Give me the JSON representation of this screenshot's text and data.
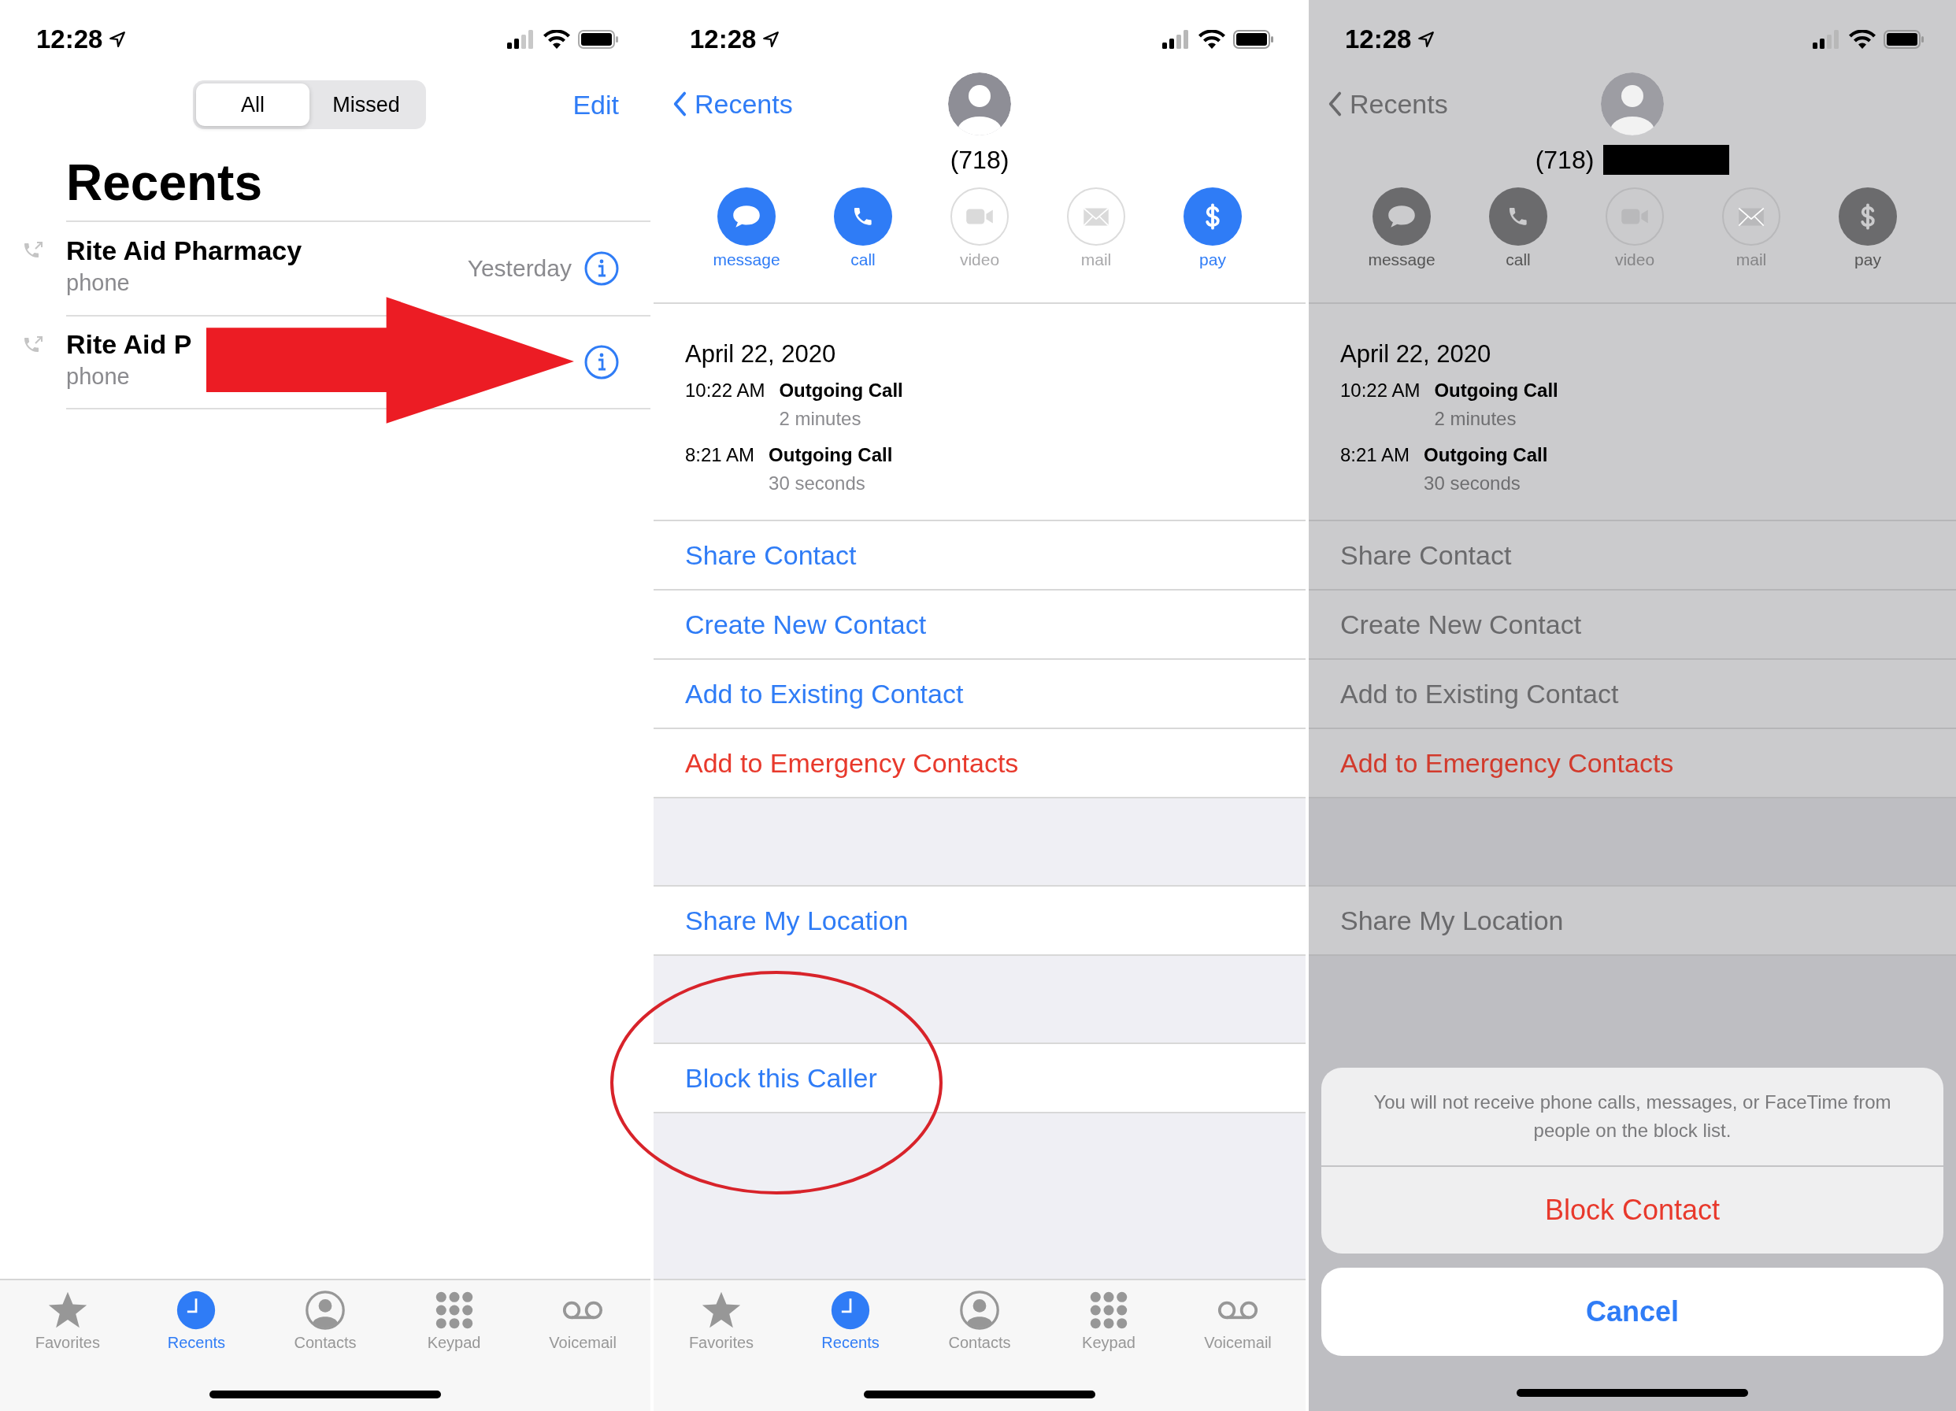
{
  "recents_screen": {
    "status": {
      "time": "12:28"
    },
    "segments": [
      {
        "label": "All",
        "selected": true
      },
      {
        "label": "Missed",
        "selected": false
      }
    ],
    "edit": "Edit",
    "title": "Recents",
    "calls": [
      {
        "name": "Rite Aid Pharmacy",
        "type": "phone",
        "date": "Yesterday"
      },
      {
        "name": "Rite Aid P",
        "type": "phone"
      }
    ],
    "annotation": {
      "kind": "arrow"
    },
    "tab_bar": [
      {
        "label": "Favorites",
        "kind": "star",
        "selected": false
      },
      {
        "label": "Recents",
        "kind": "clock",
        "selected": true
      },
      {
        "label": "Contacts",
        "kind": "person",
        "selected": false
      },
      {
        "label": "Keypad",
        "kind": "keypad",
        "selected": false
      },
      {
        "label": "Voicemail",
        "kind": "voicemail",
        "selected": false
      }
    ]
  },
  "detail_screens": [
    {
      "dimmed": false,
      "status": {
        "time": "12:28"
      },
      "back": "Recents",
      "number": "(718)",
      "redacted": false,
      "actions": [
        {
          "label": "message",
          "kind": "message",
          "disabled": false
        },
        {
          "label": "call",
          "kind": "call",
          "disabled": false
        },
        {
          "label": "video",
          "kind": "video",
          "disabled": true
        },
        {
          "label": "mail",
          "kind": "mail",
          "disabled": true
        },
        {
          "label": "pay",
          "kind": "pay",
          "disabled": false
        }
      ],
      "date": "April 22, 2020",
      "history": [
        {
          "time": "10:22 AM",
          "type": "Outgoing Call",
          "duration": "2 minutes"
        },
        {
          "time": "8:21 AM",
          "type": "Outgoing Call",
          "duration": "30 seconds"
        }
      ],
      "sections": [
        {
          "items": [
            {
              "label": "Share Contact",
              "destructive": false
            },
            {
              "label": "Create New Contact",
              "destructive": false
            },
            {
              "label": "Add to Existing Contact",
              "destructive": false
            },
            {
              "label": "Add to Emergency Contacts",
              "destructive": true
            }
          ]
        },
        {
          "items": [
            {
              "label": "Share My Location",
              "destructive": false
            }
          ]
        },
        {
          "items": [
            {
              "label": "Block this Caller",
              "destructive": false
            }
          ]
        }
      ],
      "annotation": {
        "kind": "ellipse"
      },
      "tab_bar": [
        {
          "label": "Favorites",
          "kind": "star",
          "selected": false
        },
        {
          "label": "Recents",
          "kind": "clock",
          "selected": true
        },
        {
          "label": "Contacts",
          "kind": "person",
          "selected": false
        },
        {
          "label": "Keypad",
          "kind": "keypad",
          "selected": false
        },
        {
          "label": "Voicemail",
          "kind": "voicemail",
          "selected": false
        }
      ]
    },
    {
      "dimmed": true,
      "status": {
        "time": "12:28"
      },
      "back": "Recents",
      "number": "(718)",
      "redacted": true,
      "actions": [
        {
          "label": "message",
          "kind": "message",
          "disabled": false
        },
        {
          "label": "call",
          "kind": "call",
          "disabled": false
        },
        {
          "label": "video",
          "kind": "video",
          "disabled": true
        },
        {
          "label": "mail",
          "kind": "mail",
          "disabled": true
        },
        {
          "label": "pay",
          "kind": "pay",
          "disabled": false
        }
      ],
      "date": "April 22, 2020",
      "history": [
        {
          "time": "10:22 AM",
          "type": "Outgoing Call",
          "duration": "2 minutes"
        },
        {
          "time": "8:21 AM",
          "type": "Outgoing Call",
          "duration": "30 seconds"
        }
      ],
      "sections": [
        {
          "items": [
            {
              "label": "Share Contact",
              "destructive": false
            },
            {
              "label": "Create New Contact",
              "destructive": false
            },
            {
              "label": "Add to Existing Contact",
              "destructive": false
            },
            {
              "label": "Add to Emergency Contacts",
              "destructive": true
            }
          ]
        },
        {
          "items": [
            {
              "label": "Share My Location",
              "destructive": false
            }
          ]
        }
      ],
      "action_sheet": {
        "message": "You will not receive phone calls, messages, or FaceTime from people on the block list.",
        "destructive": "Block Contact",
        "cancel": "Cancel"
      }
    }
  ]
}
